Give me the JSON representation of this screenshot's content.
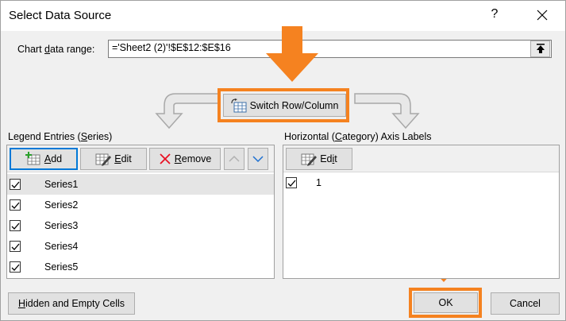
{
  "dialog": {
    "title": "Select Data Source",
    "help_label": "?"
  },
  "chart_range": {
    "label_pre": "Chart ",
    "label_accel": "d",
    "label_post": "ata range:",
    "value": "='Sheet2 (2)'!$E$12:$E$16"
  },
  "switch_button": {
    "label_accel": "W",
    "label_post": "Switch Row/Column"
  },
  "legend": {
    "heading_pre": "Legend Entries (",
    "heading_accel": "S",
    "heading_post": "eries)",
    "add_pre": "",
    "add_accel": "A",
    "add_post": "dd",
    "edit_accel": "E",
    "edit_post": "dit",
    "remove_accel": "R",
    "remove_post": "emove",
    "series": [
      "Series1",
      "Series2",
      "Series3",
      "Series4",
      "Series5"
    ]
  },
  "axis": {
    "heading_pre": "Horizontal (",
    "heading_accel": "C",
    "heading_post": "ategory) Axis Labels",
    "edit_pre": "Ed",
    "edit_accel": "i",
    "edit_post": "t",
    "labels": [
      "1"
    ]
  },
  "footer": {
    "hidden_accel": "H",
    "hidden_post": "idden and Empty Cells",
    "ok_label": "OK",
    "cancel_label": "Cancel"
  },
  "colors": {
    "annotation_orange": "#f58220",
    "focus_blue": "#0078d7",
    "remove_red": "#e81123"
  }
}
